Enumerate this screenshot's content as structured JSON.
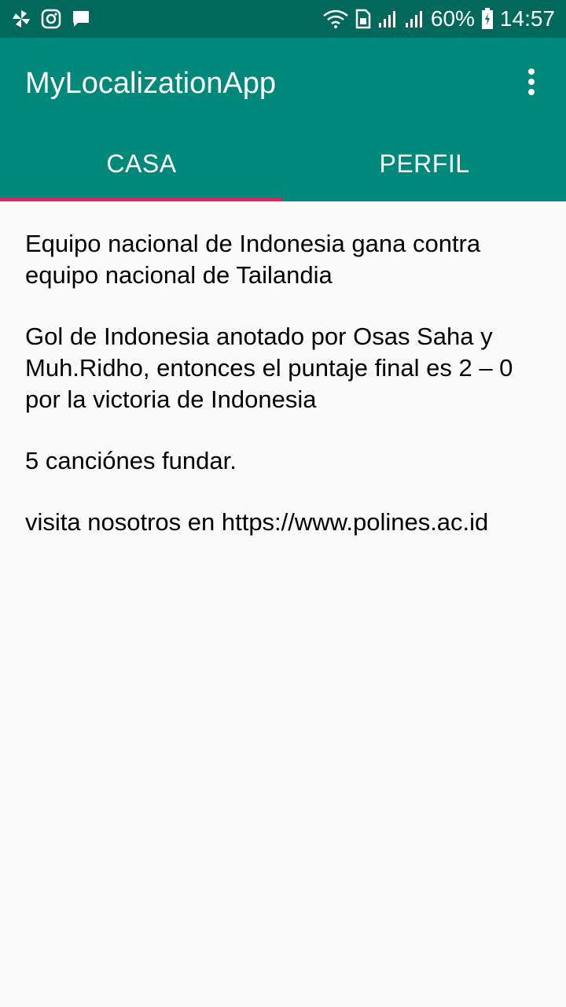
{
  "status_bar": {
    "icons_left": [
      "pinwheel-icon",
      "instagram-icon",
      "chat-icon"
    ],
    "icons_right": [
      "wifi-icon",
      "sim-icon",
      "signal-icon-1",
      "signal-icon-2",
      "battery-icon"
    ],
    "battery": "60%",
    "time": "14:57"
  },
  "app_bar": {
    "title": "MyLocalizationApp",
    "menu_icon": "overflow-menu-icon"
  },
  "tabs": [
    {
      "label": "CASA",
      "selected": true
    },
    {
      "label": "PERFIL",
      "selected": false
    }
  ],
  "content": {
    "paragraph_1": "Equipo nacional de Indonesia gana contra equipo nacional de Tailandia",
    "paragraph_2": "Gol de Indonesia anotado por Osas Saha y Muh.Ridho, entonces el puntaje final es 2 – 0 por la victoria de Indonesia",
    "paragraph_3": "5 canciónes fundar.",
    "paragraph_4": "visita nosotros en https://www.polines.ac.id"
  },
  "colors": {
    "status_bar": "#00695c",
    "app_bar": "#00897b",
    "tab_indicator": "#e91e63",
    "background": "#fafafa"
  }
}
